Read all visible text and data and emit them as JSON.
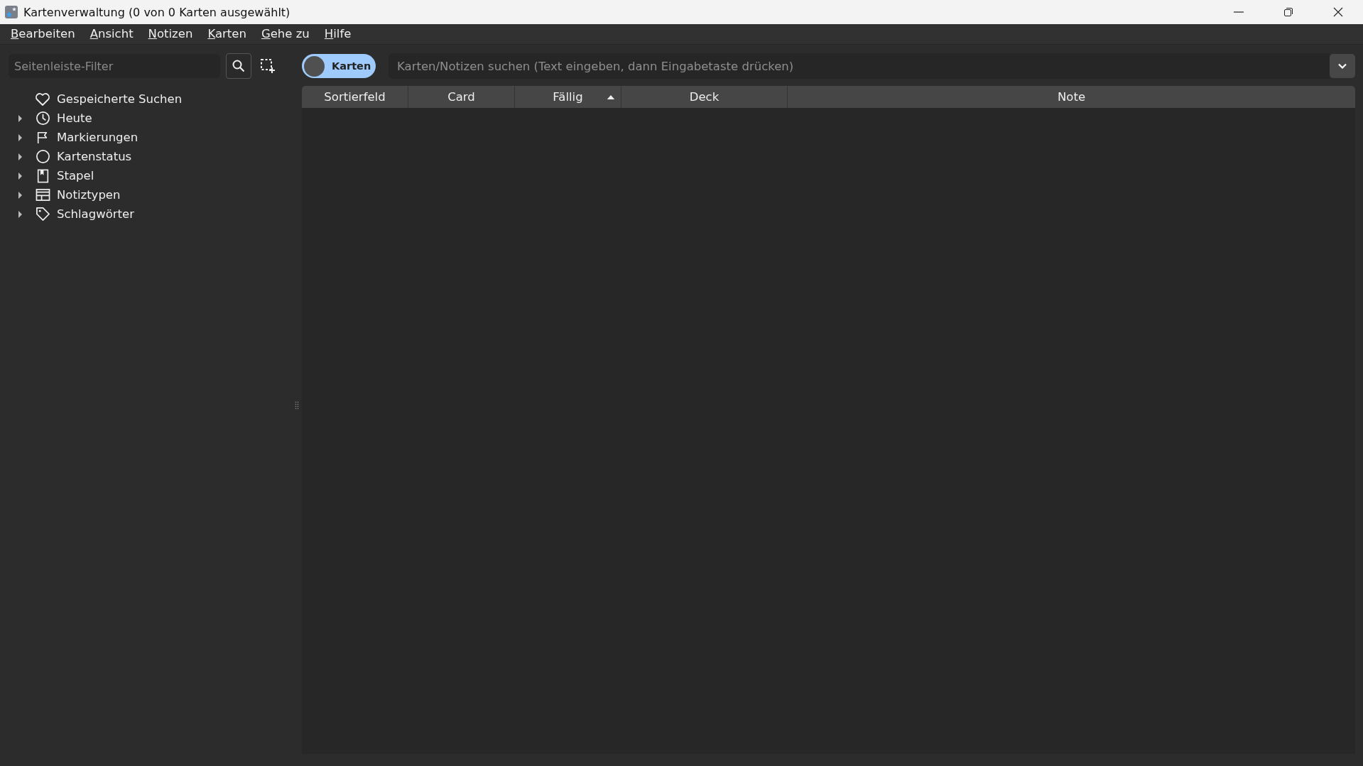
{
  "window": {
    "title": "Kartenverwaltung (0 von 0 Karten ausgewählt)"
  },
  "menu": [
    "Bearbeiten",
    "Ansicht",
    "Notizen",
    "Karten",
    "Gehe zu",
    "Hilfe"
  ],
  "sidebar": {
    "filter": {
      "placeholder": "Seitenleiste-Filter"
    },
    "items": [
      {
        "label": "Gespeicherte Suchen",
        "expandable": false,
        "expanded": false
      },
      {
        "label": "Heute",
        "expandable": true,
        "expanded": false
      },
      {
        "label": "Markierungen",
        "expandable": true,
        "expanded": false
      },
      {
        "label": "Kartenstatus",
        "expandable": true,
        "expanded": false
      },
      {
        "label": "Stapel",
        "expandable": true,
        "expanded": false
      },
      {
        "label": "Notiztypen",
        "expandable": true,
        "expanded": false
      },
      {
        "label": "Schlagwörter",
        "expandable": true,
        "expanded": false
      }
    ]
  },
  "mode_toggle": {
    "label": "Karten",
    "on": false
  },
  "search": {
    "placeholder": "Karten/Notizen suchen (Text eingeben, dann Eingabetaste drücken)"
  },
  "table": {
    "columns": [
      {
        "label": "Sortierfeld",
        "sorted": false
      },
      {
        "label": "Card",
        "sorted": false
      },
      {
        "label": "Fällig",
        "sorted": true
      },
      {
        "label": "Deck",
        "sorted": false
      },
      {
        "label": "Note",
        "sorted": false
      }
    ]
  }
}
